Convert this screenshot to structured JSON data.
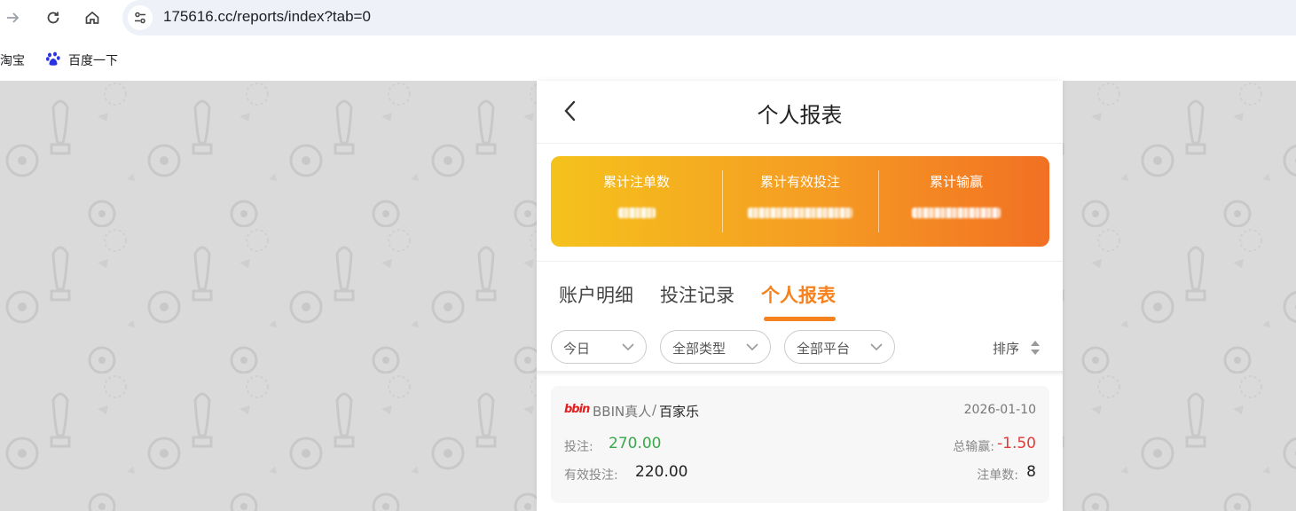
{
  "browser": {
    "url": "175616.cc/reports/index?tab=0",
    "bookmarks": [
      {
        "label": "淘宝"
      },
      {
        "label": "百度一下"
      }
    ]
  },
  "header": {
    "title": "个人报表"
  },
  "summary": {
    "items": [
      {
        "label": "累计注单数"
      },
      {
        "label": "累计有效投注"
      },
      {
        "label": "累计输赢"
      }
    ]
  },
  "tabs": [
    {
      "label": "账户明细",
      "active": false
    },
    {
      "label": "投注记录",
      "active": false
    },
    {
      "label": "个人报表",
      "active": true
    }
  ],
  "filters": [
    {
      "label": "今日"
    },
    {
      "label": "全部类型"
    },
    {
      "label": "全部平台"
    }
  ],
  "sort": {
    "label": "排序"
  },
  "records": [
    {
      "logo": "bbin",
      "provider": "BBIN真人",
      "separator": "/",
      "game": "百家乐",
      "date": "2026-01-10",
      "bet_label": "投注:",
      "bet_value": "270.00",
      "valid_bet_label": "有效投注:",
      "valid_bet_value": "220.00",
      "win_loss_label": "总输赢:",
      "win_loss_value": "-1.50",
      "count_label": "注单数:",
      "count_value": "8"
    }
  ],
  "colors": {
    "accent": "#f5821f",
    "bet_green": "#3aa84a",
    "loss_red": "#e03a3a",
    "summary_gradient": [
      "#f5c21c",
      "#f59b23",
      "#f27023"
    ]
  }
}
